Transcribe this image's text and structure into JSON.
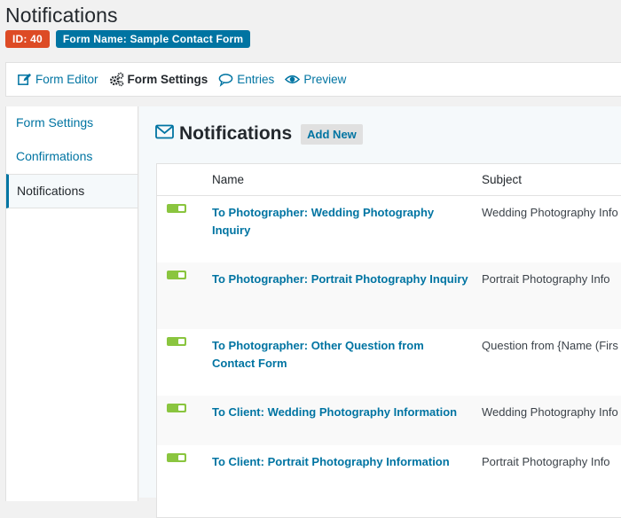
{
  "page": {
    "title": "Notifications"
  },
  "badges": {
    "id": "ID: 40",
    "form_name": "Form Name: Sample Contact Form"
  },
  "toolbar": [
    {
      "label": "Form Editor",
      "icon": "edit-icon"
    },
    {
      "label": "Form Settings",
      "icon": "gears-icon",
      "active": true
    },
    {
      "label": "Entries",
      "icon": "comment-icon"
    },
    {
      "label": "Preview",
      "icon": "eye-icon"
    }
  ],
  "sidebar": {
    "items": [
      {
        "label": "Form Settings"
      },
      {
        "label": "Confirmations"
      },
      {
        "label": "Notifications",
        "active": true
      }
    ]
  },
  "main": {
    "title": "Notifications",
    "add_new": "Add New",
    "columns": {
      "name": "Name",
      "subject": "Subject"
    },
    "rows": [
      {
        "name": "To Photographer: Wedding Photography Inquiry",
        "subject": "Wedding Photography Info",
        "active": true
      },
      {
        "name": "To Photographer: Portrait Photography Inquiry",
        "subject": "Portrait Photography Info",
        "active": true
      },
      {
        "name": "To Photographer: Other Question from Contact Form",
        "subject": "Question from {Name (Firs",
        "active": true
      },
      {
        "name": "To Client: Wedding Photography Information",
        "subject": "Wedding Photography Info",
        "active": true
      },
      {
        "name": "To Client: Portrait Photography Information",
        "subject": "Portrait Photography Info",
        "active": true
      }
    ]
  },
  "colors": {
    "link": "#0074a2",
    "badge_id": "#dd4b25",
    "badge_form": "#0074a2",
    "toggle_on": "#8ac53f"
  }
}
